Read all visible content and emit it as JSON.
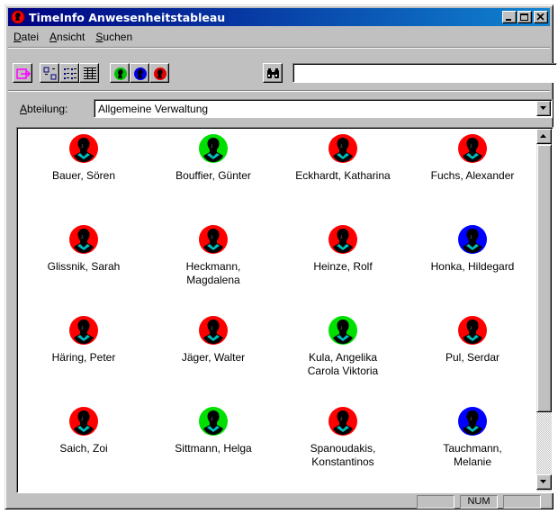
{
  "window": {
    "title": "TimeInfo Anwesenheitstableau",
    "icon": "app-globe-icon"
  },
  "menu": {
    "items": [
      {
        "label": "Datei",
        "underline": "D"
      },
      {
        "label": "Ansicht",
        "underline": "A"
      },
      {
        "label": "Suchen",
        "underline": "S"
      }
    ]
  },
  "toolbar": {
    "buttons": [
      "exit-icon",
      "large-icons-view-icon",
      "list-view-icon",
      "details-view-icon",
      "status-present-icon",
      "status-absent-icon",
      "status-away-icon",
      "binoculars-search-icon"
    ],
    "search_value": ""
  },
  "department": {
    "label": "Abteilung:",
    "value": "Allgemeine Verwaltung"
  },
  "status_colors": {
    "red": "#ff0000",
    "green": "#00e000",
    "blue": "#0000ff"
  },
  "people": [
    {
      "name": "Bauer, Sören",
      "status": "red"
    },
    {
      "name": "Bouffier, Günter",
      "status": "green"
    },
    {
      "name": "Eckhardt, Katharina",
      "status": "red"
    },
    {
      "name": "Fuchs, Alexander",
      "status": "red"
    },
    {
      "name": "Glissnik, Sarah",
      "status": "red"
    },
    {
      "name": "Heckmann,\nMagdalena",
      "status": "red"
    },
    {
      "name": "Heinze, Rolf",
      "status": "red"
    },
    {
      "name": "Honka, Hildegard",
      "status": "blue"
    },
    {
      "name": "Häring, Peter",
      "status": "red"
    },
    {
      "name": "Jäger, Walter",
      "status": "red"
    },
    {
      "name": "Kula, Angelika\nCarola Viktoria",
      "status": "green"
    },
    {
      "name": "Pul, Serdar",
      "status": "red"
    },
    {
      "name": "Saich, Zoi",
      "status": "red"
    },
    {
      "name": "Sittmann, Helga",
      "status": "green"
    },
    {
      "name": "Spanoudakis,\nKonstantinos",
      "status": "red"
    },
    {
      "name": "Tauchmann,\nMelanie",
      "status": "blue"
    }
  ],
  "statusbar": {
    "panel1": "",
    "num": "NUM",
    "panel3": ""
  }
}
